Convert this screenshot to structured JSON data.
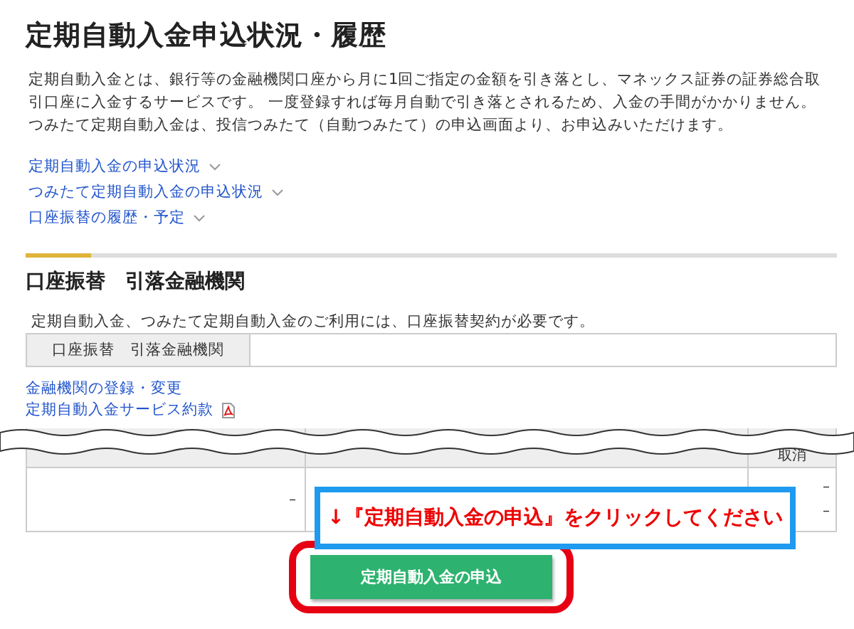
{
  "title": "定期自動入金申込状況・履歴",
  "description": "定期自動入金とは、銀行等の金融機関口座から月に1回ご指定の金額を引き落とし、マネックス証券の証券総合取引口座に入金するサービスです。 一度登録すれば毎月自動で引き落とされるため、入金の手間がかかりません。つみたて定期自動入金は、投信つみたて（自動つみたて）の申込画面より、お申込みいただけます。",
  "links": [
    {
      "label": "定期自動入金の申込状況",
      "expanded": false
    },
    {
      "label": "つみたて定期自動入金の申込状況",
      "expanded": false
    },
    {
      "label": "口座振替の履歴・予定",
      "expanded": false
    }
  ],
  "section": {
    "heading": "口座振替　引落金融機関",
    "note": "定期自動入金、つみたて定期自動入金のご利用には、口座振替契約が必要です。",
    "table_label": "口座振替　引落金融機関",
    "links": [
      {
        "label": "金融機関の登録・変更",
        "kind": "link"
      },
      {
        "label": "定期自動入金サービス約款",
        "kind": "pdf"
      }
    ]
  },
  "apply_table": {
    "header": {
      "column_3": "取消"
    },
    "row": {
      "column_1": "–",
      "column_3": [
        "–",
        "–"
      ]
    }
  },
  "callout": "↓『定期自動入金の申込』をクリックしてください",
  "button": {
    "label": "定期自動入金の申込",
    "highlighted": true
  }
}
